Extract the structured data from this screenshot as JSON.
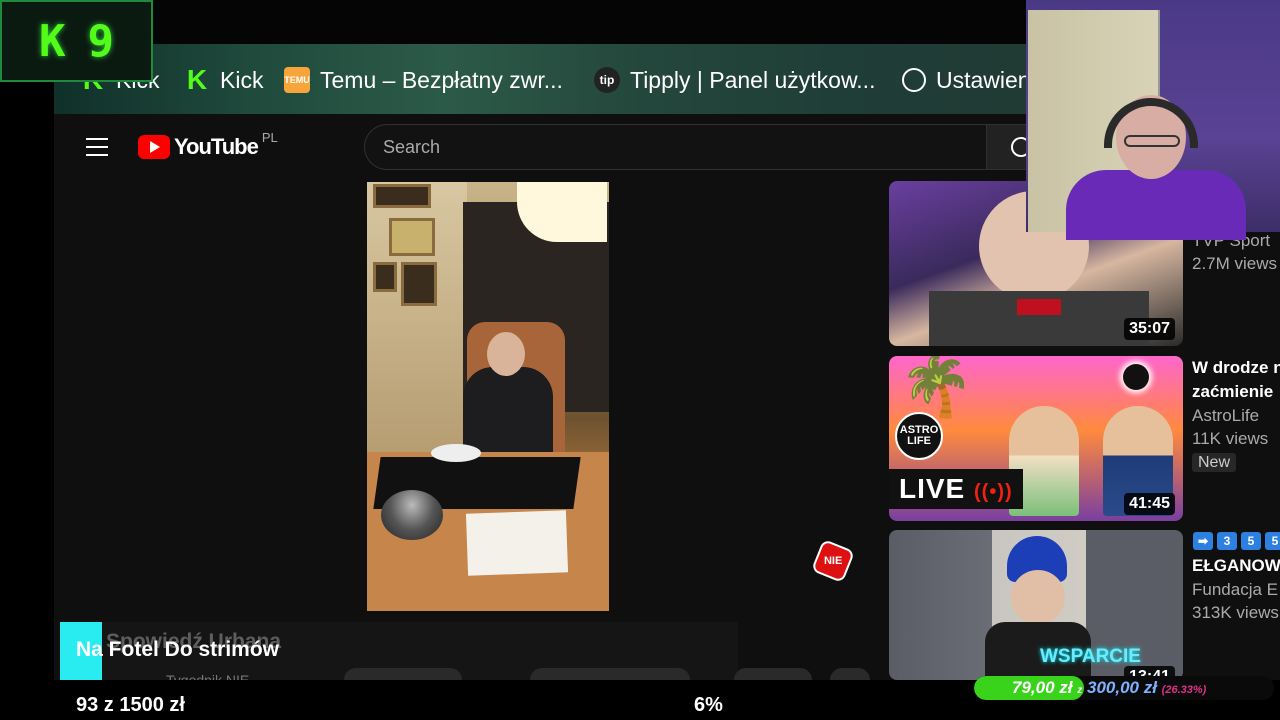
{
  "overlay": {
    "logo_left": "K",
    "logo_right": "9"
  },
  "bookmarks": [
    {
      "label": "Kick",
      "icon": "kick-icon"
    },
    {
      "label": "Kick",
      "icon": "kick-icon"
    },
    {
      "label": "Temu – Bezpłatny zwr...",
      "icon": "temu-icon"
    },
    {
      "label": "Tipply | Panel użytkow...",
      "icon": "tipply-icon"
    },
    {
      "label": "Ustawien",
      "icon": "globe-icon"
    }
  ],
  "icon_text": {
    "temu": "TEMU",
    "tip": "tip"
  },
  "youtube": {
    "logo_text": "YouTube",
    "country": "PL",
    "search_placeholder": "Search"
  },
  "main_video": {
    "badge": "NIE"
  },
  "related": [
    {
      "duration": "35:07",
      "channel": "TVP Sport",
      "views": "2.7M views"
    },
    {
      "title_line1": "W drodze n",
      "title_line2": "zaćmienie",
      "duration": "41:45",
      "live_label": "LIVE",
      "astro_label": "ASTRO LIFE",
      "channel": "AstroLife",
      "views": "11K views",
      "badge": "New"
    },
    {
      "emoji": [
        "➡",
        "3",
        "5",
        "5"
      ],
      "title": "EŁGANOW",
      "channel": "Fundacja E",
      "views": "313K views",
      "overlay": "WSPARCIE",
      "duration": "13:41"
    }
  ],
  "ticker": {
    "ghost": "Spowiedź Urbana",
    "text": "Na Fotel Do strimów",
    "ghost_channel": "Tygodnik NIE"
  },
  "goal": {
    "text": "93  z  1500  zł",
    "percent": "6%"
  },
  "donation": {
    "current": "79,00",
    "unit": "zł",
    "connector": "z",
    "target": "300,00 zł",
    "percent_label": "(26.33%)",
    "progress": 0.2633
  },
  "colors": {
    "kick_green": "#53fc18",
    "yt_red": "#ff0000",
    "ticker_accent": "#28ecf0",
    "donation_fill": "#3ad31b"
  }
}
